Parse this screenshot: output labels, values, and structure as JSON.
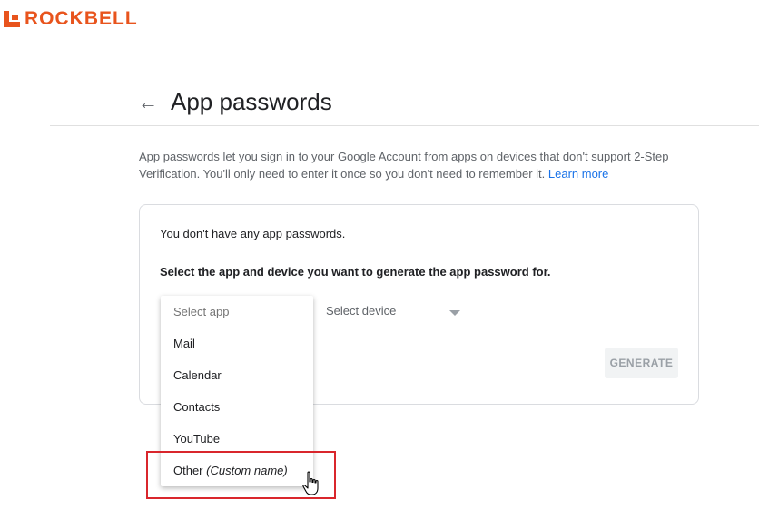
{
  "brand": {
    "name": "ROCKBELL",
    "color": "#e8541d"
  },
  "header": {
    "title": "App passwords",
    "back_icon": "arrow-left-icon"
  },
  "description": {
    "text": "App passwords let you sign in to your Google Account from apps on devices that don't support 2-Step Verification. You'll only need to enter it once so you don't need to remember it.",
    "link": "Learn more"
  },
  "card": {
    "empty_text": "You don't have any app passwords.",
    "instruction": "Select the app and device you want to generate the app password for."
  },
  "app_select": {
    "placeholder": "Select app",
    "options": [
      "Mail",
      "Calendar",
      "Contacts",
      "YouTube"
    ],
    "other_label": "Other",
    "other_hint": "(Custom name)"
  },
  "device_select": {
    "placeholder": "Select device"
  },
  "generate_label": "GENERATE",
  "colors": {
    "highlight": "#d9262c",
    "link": "#1a73e8"
  }
}
